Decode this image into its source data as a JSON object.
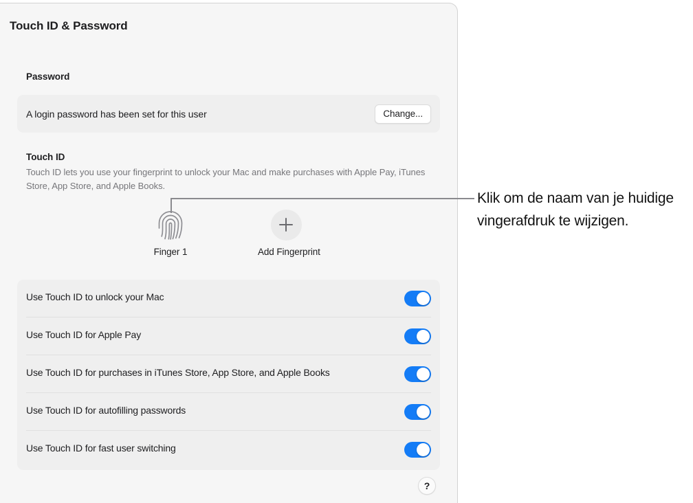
{
  "window": {
    "title": "Touch ID & Password"
  },
  "password_section": {
    "heading": "Password",
    "status_text": "A login password has been set for this user",
    "change_button_label": "Change..."
  },
  "touchid_section": {
    "heading": "Touch ID",
    "description": "Touch ID lets you use your fingerprint to unlock your Mac and make purchases with Apple Pay, iTunes Store, App Store, and Apple Books.",
    "fingerprints": [
      {
        "icon": "fingerprint-icon",
        "label": "Finger 1"
      },
      {
        "icon": "plus-icon",
        "label": "Add Fingerprint"
      }
    ]
  },
  "toggles": [
    {
      "label": "Use Touch ID to unlock your Mac",
      "state": "on"
    },
    {
      "label": "Use Touch ID for Apple Pay",
      "state": "on"
    },
    {
      "label": "Use Touch ID for purchases in iTunes Store, App Store, and Apple Books",
      "state": "on"
    },
    {
      "label": "Use Touch ID for autofilling passwords",
      "state": "on"
    },
    {
      "label": "Use Touch ID for fast user switching",
      "state": "on"
    }
  ],
  "help": {
    "icon": "question-mark-icon",
    "label": "?"
  },
  "callout": {
    "text": "Klik om de naam van je huidige vingerafdruk te wijzigen."
  },
  "colors": {
    "toggle_on": "#147cf6",
    "panel_background": "#f6f6f6",
    "card_background": "#efefef",
    "text_primary": "#1d1d1f",
    "text_secondary": "#76767a",
    "leader_line": "#8a8a8e"
  }
}
